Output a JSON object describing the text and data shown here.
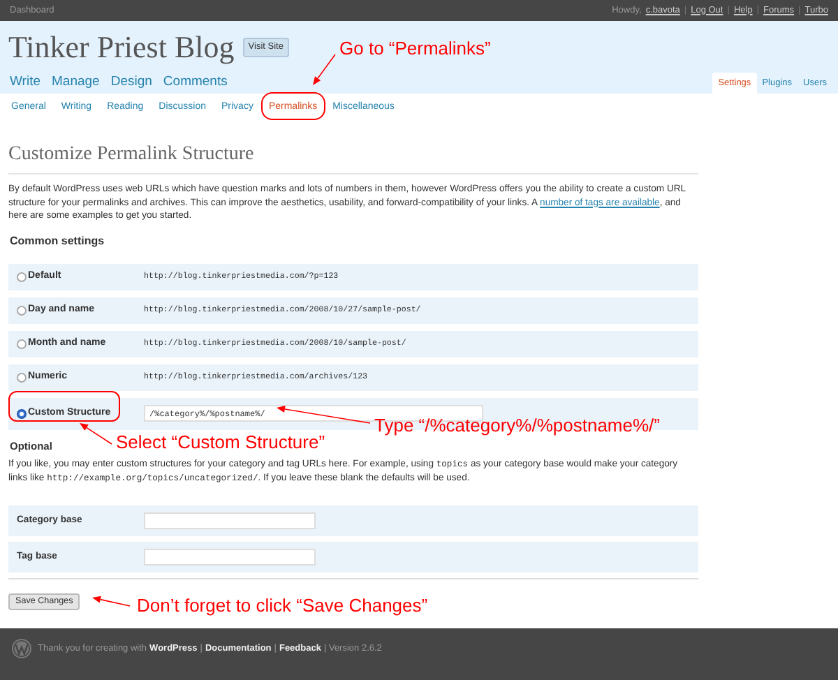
{
  "top_bar": {
    "dashboard": "Dashboard",
    "howdy": "Howdy,",
    "user": "c.bavota",
    "links": [
      {
        "separator": "|",
        "label": "Log Out"
      },
      {
        "separator": "|",
        "label": "Help"
      },
      {
        "separator": "|",
        "label": "Forums"
      },
      {
        "separator": "|",
        "label": "Turbo"
      }
    ]
  },
  "header": {
    "title": "Tinker Priest Blog",
    "visit_site": "Visit Site"
  },
  "main_nav": [
    {
      "label": "Write"
    },
    {
      "label": "Manage"
    },
    {
      "label": "Design"
    },
    {
      "label": "Comments"
    }
  ],
  "right_nav": [
    {
      "label": "Settings",
      "selected": true
    },
    {
      "label": "Plugins",
      "selected": false
    },
    {
      "label": "Users",
      "selected": false
    }
  ],
  "sub_nav": [
    {
      "label": "General",
      "selected": false
    },
    {
      "label": "Writing",
      "selected": false
    },
    {
      "label": "Reading",
      "selected": false
    },
    {
      "label": "Discussion",
      "selected": false
    },
    {
      "label": "Privacy",
      "selected": false
    },
    {
      "label": "Permalinks",
      "selected": true
    },
    {
      "label": "Miscellaneous",
      "selected": false
    }
  ],
  "heading": "Customize Permalink Structure",
  "intro": {
    "before": "By default WordPress uses web URLs which have question marks and lots of numbers in them, however WordPress offers you the ability to create a custom URL structure for your permalinks and archives. This can improve the aesthetics, usability, and forward-compatibility of your links. A ",
    "link": "number of tags are available",
    "after": ", and here are some examples to get you started."
  },
  "common_settings": "Common settings",
  "options": [
    {
      "label": "Default",
      "kind": "example",
      "example": "http://blog.tinkerpriestmedia.com/?p=123",
      "selected": false
    },
    {
      "label": "Day and name",
      "kind": "example",
      "example": "http://blog.tinkerpriestmedia.com/2008/10/27/sample-post/",
      "selected": false
    },
    {
      "label": "Month and name",
      "kind": "example",
      "example": "http://blog.tinkerpriestmedia.com/2008/10/sample-post/",
      "selected": false
    },
    {
      "label": "Numeric",
      "kind": "example",
      "example": "http://blog.tinkerpriestmedia.com/archives/123",
      "selected": false
    },
    {
      "label": "Custom Structure",
      "kind": "input",
      "value": "/%category%/%postname%/",
      "selected": true
    }
  ],
  "optional": "Optional",
  "optional_text": [
    {
      "kind": "text",
      "text": "If you like, you may enter custom structures for your category and tag URLs here. For example, using "
    },
    {
      "kind": "code",
      "text": "topics"
    },
    {
      "kind": "text",
      "text": " as your category base would make your category links like "
    },
    {
      "kind": "code",
      "text": "http://example.org/topics/uncategorized/"
    },
    {
      "kind": "text",
      "text": ". If you leave these blank the defaults will be used."
    }
  ],
  "fields": [
    {
      "label": "Category base"
    },
    {
      "label": "Tag base"
    }
  ],
  "save_button": "Save Changes",
  "footer": [
    {
      "kind": "text",
      "text": "Thank you for creating with"
    },
    {
      "kind": "link",
      "text": "WordPress"
    },
    {
      "kind": "text",
      "text": "|"
    },
    {
      "kind": "link",
      "text": "Documentation"
    },
    {
      "kind": "text",
      "text": "|"
    },
    {
      "kind": "link",
      "text": "Feedback"
    },
    {
      "kind": "text",
      "text": "| Version 2.6.2"
    }
  ],
  "annotations": [
    {
      "text": "Go to “Permalinks”"
    },
    {
      "text": "Type “/%category%/%postname%/”"
    },
    {
      "text": "Select “Custom Structure”"
    },
    {
      "text": "Don’t forget to click “Save Changes”"
    }
  ]
}
